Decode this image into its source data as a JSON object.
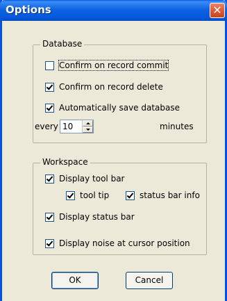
{
  "window": {
    "title": "Options",
    "close_glyph": "✕"
  },
  "database": {
    "label": "Database",
    "confirm_commit": {
      "label": "Confirm on record commit",
      "checked": false
    },
    "confirm_delete": {
      "label": "Confirm on record delete",
      "checked": true
    },
    "auto_save": {
      "label": "Automatically save database",
      "checked": true
    },
    "every_label": "every",
    "interval_value": "10",
    "minutes_label": "minutes"
  },
  "workspace": {
    "label": "Workspace",
    "display_toolbar": {
      "label": "Display tool bar",
      "checked": true
    },
    "tool_tip": {
      "label": "tool tip",
      "checked": true
    },
    "status_bar_info": {
      "label": "status bar info",
      "checked": true
    },
    "display_status_bar": {
      "label": "Display status bar",
      "checked": true
    },
    "display_noise": {
      "label": "Display noise at cursor position",
      "checked": true
    }
  },
  "buttons": {
    "ok": "OK",
    "cancel": "Cancel"
  }
}
